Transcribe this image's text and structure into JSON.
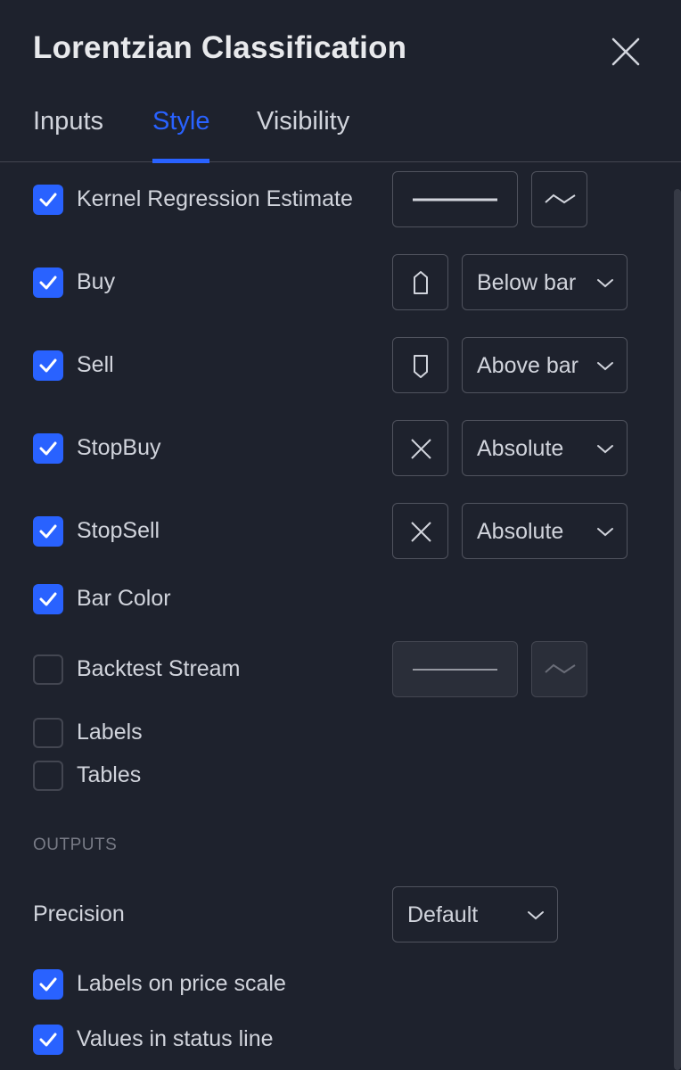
{
  "dialog": {
    "title": "Lorentzian Classification"
  },
  "tabs": [
    {
      "label": "Inputs"
    },
    {
      "label": "Style"
    },
    {
      "label": "Visibility"
    }
  ],
  "active_tab": "Style",
  "accent_color": "#2962ff",
  "plots": [
    {
      "label": "Kernel Regression Estimate",
      "checked": true,
      "controls": [
        "line-style-icon",
        "plot-type-line-icon"
      ]
    },
    {
      "label": "Buy",
      "checked": true,
      "shape_icon": "arrow-up-shape-icon",
      "location": "Below bar"
    },
    {
      "label": "Sell",
      "checked": true,
      "shape_icon": "arrow-down-shape-icon",
      "location": "Above bar"
    },
    {
      "label": "StopBuy",
      "checked": true,
      "shape_icon": "x-cross-icon",
      "location": "Absolute"
    },
    {
      "label": "StopSell",
      "checked": true,
      "shape_icon": "x-cross-icon",
      "location": "Absolute"
    },
    {
      "label": "Bar Color",
      "checked": true
    },
    {
      "label": "Backtest Stream",
      "checked": false,
      "controls": [
        "line-style-icon",
        "plot-type-line-icon"
      ]
    },
    {
      "label": "Labels",
      "checked": false
    },
    {
      "label": "Tables",
      "checked": false
    }
  ],
  "outputs": {
    "section_title": "OUTPUTS",
    "precision_label": "Precision",
    "precision_value": "Default",
    "labels_on_price_scale": {
      "label": "Labels on price scale",
      "checked": true
    },
    "values_in_status_line": {
      "label": "Values in status line",
      "checked": true
    }
  }
}
